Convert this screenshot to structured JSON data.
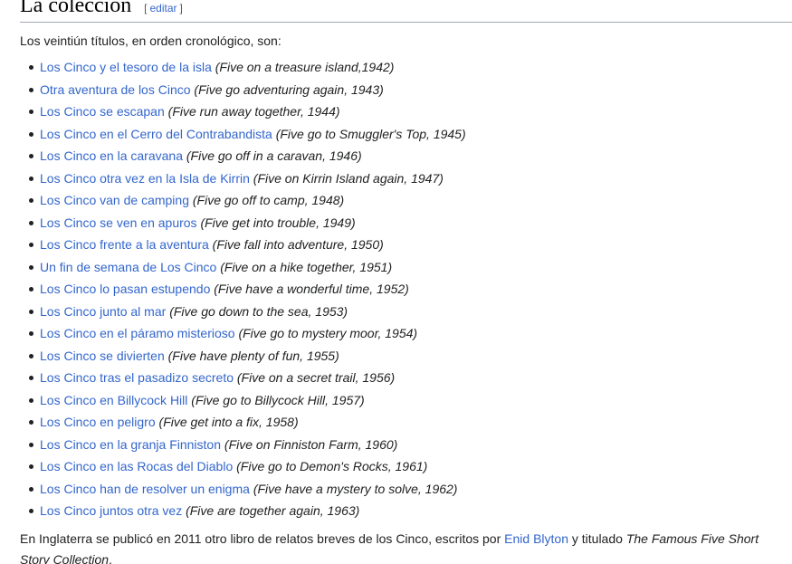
{
  "section": {
    "title": "La colección",
    "edit_open": "[",
    "edit_label": "editar",
    "edit_close": "]"
  },
  "intro": "Los veintiún títulos, en orden cronológico, son:",
  "books": [
    {
      "title": "Los Cinco y el tesoro de la isla",
      "original": "(Five on a treasure island,1942)"
    },
    {
      "title": "Otra aventura de los Cinco",
      "original": "(Five go adventuring again, 1943)"
    },
    {
      "title": "Los Cinco se escapan",
      "original": "(Five run away together, 1944)"
    },
    {
      "title": "Los Cinco en el Cerro del Contrabandista",
      "original": "(Five go to Smuggler's Top, 1945)"
    },
    {
      "title": "Los Cinco en la caravana",
      "original": "(Five go off in a caravan, 1946)"
    },
    {
      "title": "Los Cinco otra vez en la Isla de Kirrin",
      "original": "(Five on Kirrin Island again, 1947)"
    },
    {
      "title": "Los Cinco van de camping",
      "original": "(Five go off to camp, 1948)"
    },
    {
      "title": "Los Cinco se ven en apuros",
      "original": "(Five get into trouble, 1949)"
    },
    {
      "title": "Los Cinco frente a la aventura",
      "original": "(Five fall into adventure, 1950)"
    },
    {
      "title": "Un fin de semana de Los Cinco",
      "original": "(Five on a hike together, 1951)"
    },
    {
      "title": "Los Cinco lo pasan estupendo",
      "original": "(Five have a wonderful time, 1952)"
    },
    {
      "title": "Los Cinco junto al mar",
      "original": "(Five go down to the sea, 1953)"
    },
    {
      "title": "Los Cinco en el páramo misterioso",
      "original": "(Five go to mystery moor, 1954)"
    },
    {
      "title": "Los Cinco se divierten",
      "original": "(Five have plenty of fun, 1955)"
    },
    {
      "title": "Los Cinco tras el pasadizo secreto",
      "original": "(Five on a secret trail, 1956)"
    },
    {
      "title": "Los Cinco en Billycock Hill",
      "original": "(Five go to Billycock Hill, 1957)"
    },
    {
      "title": "Los Cinco en peligro",
      "original": "(Five get into a fix, 1958)"
    },
    {
      "title": "Los Cinco en la granja Finniston",
      "original": "(Five on Finniston Farm, 1960)"
    },
    {
      "title": "Los Cinco en las Rocas del Diablo",
      "original": "(Five go to Demon's Rocks, 1961)"
    },
    {
      "title": "Los Cinco han de resolver un enigma",
      "original": "(Five have a mystery to solve, 1962)"
    },
    {
      "title": "Los Cinco juntos otra vez",
      "original": "(Five are together again, 1963)"
    }
  ],
  "outro": {
    "before_link": "En Inglaterra se publicó en 2011 otro libro de relatos breves de los Cinco, escritos por ",
    "author_link": "Enid Blyton",
    "after_link": " y titulado ",
    "book_title": "The Famous Five Short Story Collection",
    "end": "."
  },
  "colors": {
    "link": "#3366cc",
    "text": "#202122",
    "rule": "#a2a9b1"
  }
}
